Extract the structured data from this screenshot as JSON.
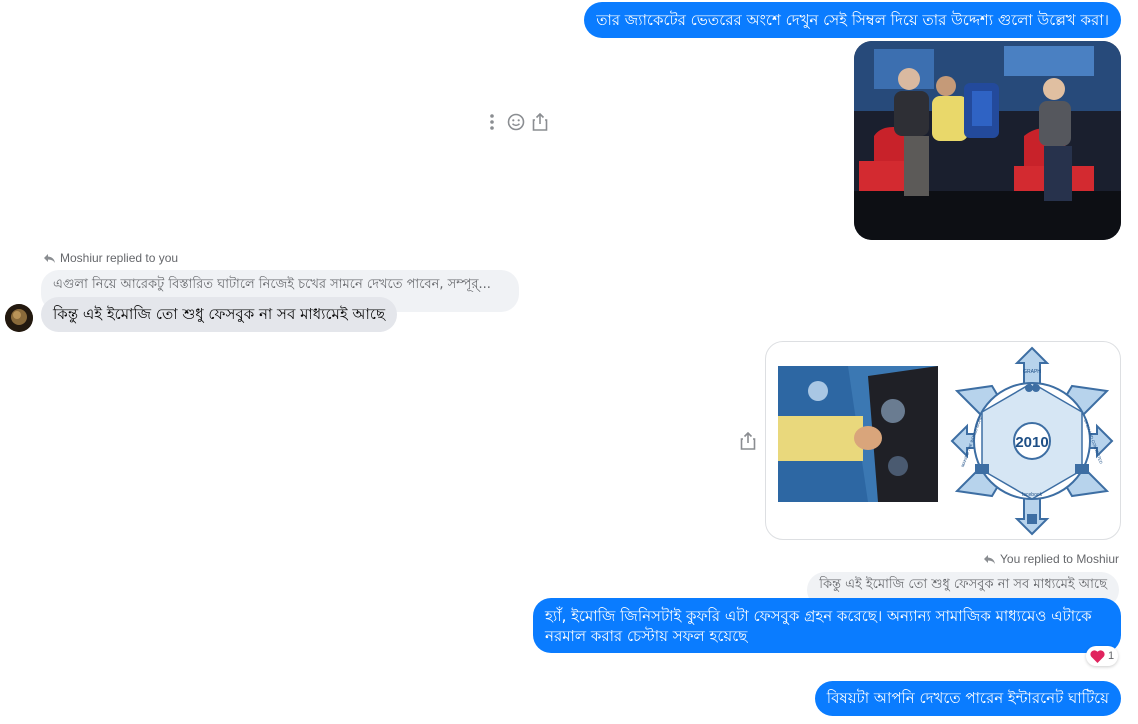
{
  "messages": {
    "m1": "তার জ্যাকেটের ভেতরের অংশে দেখুন সেই সিম্বল দিয়ে তার উদ্দেশ্য গুলো উল্লেখ করা।",
    "reply_in_label": "Moshiur replied to you",
    "quoted_in": "এগুলা নিয়ে আরেকটু বিস্তারিত ঘাটালে নিজেই চখের সামনে দেখতে পাবেন, সম্পূর্...",
    "m2": "কিন্তু এই ইমোজি তো শুধু ফেসবুক না সব মাধ্যমেই আছে",
    "reply_out_label": "You replied to Moshiur",
    "quoted_out": "কিন্তু এই ইমোজি তো শুধু ফেসবুক না সব মাধ্যমেই আছে",
    "m3": "হ্যাঁ, ইমোজি জিনিসটাই কুফরি এটা ফেসবুক গ্রহন করেছে। অন্যান্য সামাজিক মাধ্যমেও এটাকে নরমাল করার চেস্টায় সফল হয়েছে",
    "reaction_count": "1",
    "m4": "বিষয়টা আপনি দেখতে পারেন ইন্টারনেট ঘাটিয়ে"
  },
  "diagram": {
    "center_label": "2010",
    "top_label": "GRAPH",
    "ring_left": "MAKING THE WORLD MORE",
    "ring_right": "OPEN AND CONNECTED",
    "bottom_label": "facebook"
  },
  "colors": {
    "outgoing": "#0a7cff",
    "incoming": "#e4e6eb",
    "reaction": "#e0245e"
  },
  "icons": [
    "more-icon",
    "emoji-icon",
    "share-icon",
    "reply-arrow-icon",
    "heart-icon"
  ]
}
